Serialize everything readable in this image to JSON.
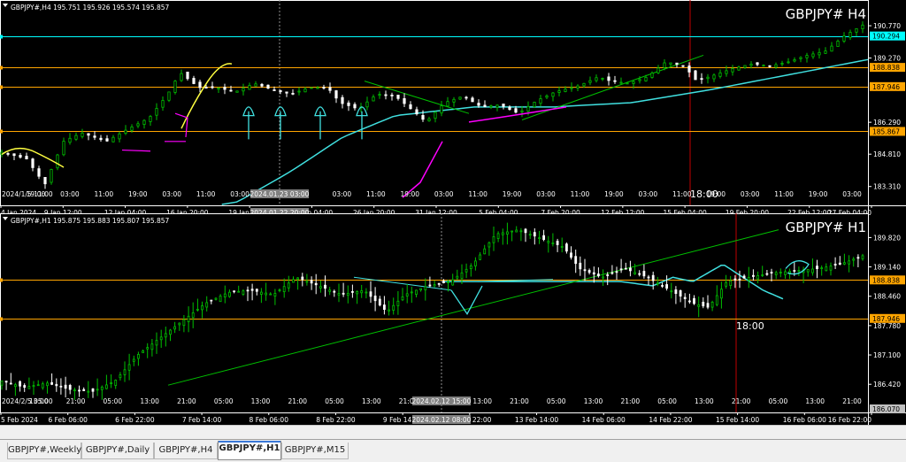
{
  "panes": [
    {
      "id": "h4",
      "info": "GBPJPY#,H4  195.751 195.926 195.574 195.857",
      "title": "GBPJPY# H4",
      "y_ticks": [
        "190.770",
        "189.270",
        "186.290",
        "184.810",
        "183.310"
      ],
      "y_range": [
        182.6,
        191.8
      ],
      "x_ticks": [
        "4 Jan 2024",
        "9 Jan 12:00",
        "12 Jan 04:00",
        "16 Jan 20:00",
        "19 Jan 12:00",
        "24 Jan 04:00",
        "26 Jan 20:00",
        "31 Jan 12:00",
        "5 Feb 04:00",
        "7 Feb 20:00",
        "12 Feb 12:00",
        "15 Feb 04:00",
        "19 Feb 20:00",
        "22 Feb 12:00",
        "27 Feb 04:00"
      ],
      "x_ticks_minor": [
        "2024/1/5 11:00",
        "19:00",
        "03:00",
        "11:00",
        "19:00",
        "03:00",
        "11:00",
        "03:00",
        "11:00",
        "19:00",
        "03:00",
        "11:00",
        "19:00",
        "03:00",
        "11:00",
        "19:00",
        "03:00",
        "11:00",
        "19:00",
        "03:00",
        "11:00",
        "19:00",
        "03:00",
        "11:00",
        "19:00",
        "03:00"
      ],
      "cursor_time_top": "2024.01.23 03:00",
      "cursor_time_bottom": "2024.01.22 20:00",
      "vline_label": "18:00",
      "price_labels": [
        {
          "text": "190.294",
          "value": 190.294,
          "bg": "#00ffff",
          "fg": "#000000"
        },
        {
          "text": "188.838",
          "value": 188.838,
          "bg": "#ffa500",
          "fg": "#000000"
        },
        {
          "text": "187.946",
          "value": 187.946,
          "bg": "#ffa500",
          "fg": "#000000"
        },
        {
          "text": "185.867",
          "value": 185.867,
          "bg": "#ffa500",
          "fg": "#000000"
        }
      ]
    },
    {
      "id": "h1",
      "info": "GBPJPY#,H1  195.875 195.883 195.807 195.857",
      "title": "GBPJPY# H1",
      "y_ticks": [
        "189.820",
        "189.140",
        "188.460",
        "187.780",
        "187.100",
        "186.420"
      ],
      "y_range": [
        185.85,
        190.3
      ],
      "x_ticks": [
        "5 Feb 2024",
        "6 Feb 06:00",
        "6 Feb 22:00",
        "7 Feb 14:00",
        "8 Feb 06:00",
        "8 Feb 22:00",
        "9 Feb 14:00",
        "12 Feb 22:00",
        "13 Feb 14:00",
        "14 Feb 06:00",
        "14 Feb 22:00",
        "15 Feb 14:00",
        "16 Feb 06:00",
        "16 Feb 22:00"
      ],
      "x_ticks_minor": [
        "2024/2/5 05:00",
        "13:00",
        "21:00",
        "05:00",
        "13:00",
        "21:00",
        "05:00",
        "13:00",
        "21:00",
        "05:00",
        "13:00",
        "21:00",
        "05:00",
        "13:00",
        "21:00",
        "05:00",
        "13:00",
        "21:00",
        "05:00",
        "13:00",
        "21:00",
        "05:00",
        "13:00",
        "21:00"
      ],
      "cursor_time_top": "2024.02.12 15:00",
      "cursor_time_bottom": "2024.02.12 08:00",
      "vline_label": "18:00",
      "price_labels": [
        {
          "text": "188.838",
          "value": 188.838,
          "bg": "#ffa500",
          "fg": "#000000"
        },
        {
          "text": "187.946",
          "value": 187.946,
          "bg": "#ffa500",
          "fg": "#000000"
        },
        {
          "text": "186.070",
          "value": 186.07,
          "bg": "#c0c0c0",
          "fg": "#000000"
        }
      ]
    }
  ],
  "tabs": [
    {
      "label": "GBPJPY#,Weekly",
      "active": false
    },
    {
      "label": "GBPJPY#,Daily",
      "active": false
    },
    {
      "label": "GBPJPY#,H4",
      "active": false
    },
    {
      "label": "GBPJPY#,H1",
      "active": true
    },
    {
      "label": "GBPJPY#,M15",
      "active": false
    }
  ],
  "colors": {
    "background": "#000000",
    "bull": "#00c000",
    "bear": "#ffffff",
    "ma": "#40e0e0",
    "orange_level": "#ffa500",
    "cyan_level": "#00ffff",
    "trendline": "#00c000",
    "annotation_magenta": "#ff00ff",
    "annotation_yellow": "#ffff40",
    "annotation_cyan": "#40e0e0",
    "vline_red": "#c00000",
    "axis_text": "#ffffff"
  },
  "chart_data": [
    {
      "type": "candlestick",
      "timeframe": "H4",
      "title": "GBPJPY# H4",
      "ylim": [
        182.6,
        191.8
      ],
      "series": [
        {
          "name": "Close",
          "x_range": [
            "2024-01-04",
            "2024-02-27 04:00"
          ],
          "anchors": [
            [
              0,
              184.9
            ],
            [
              8,
              184.6
            ],
            [
              14,
              183.4
            ],
            [
              20,
              185.4
            ],
            [
              26,
              185.8
            ],
            [
              34,
              185.4
            ],
            [
              40,
              185.9
            ],
            [
              48,
              186.5
            ],
            [
              54,
              187.6
            ],
            [
              58,
              188.6
            ],
            [
              64,
              187.9
            ],
            [
              70,
              187.9
            ],
            [
              76,
              187.7
            ],
            [
              82,
              188.1
            ],
            [
              88,
              187.8
            ],
            [
              94,
              187.6
            ],
            [
              100,
              187.9
            ],
            [
              106,
              187.9
            ],
            [
              110,
              187.2
            ],
            [
              116,
              186.9
            ],
            [
              122,
              187.6
            ],
            [
              128,
              187.5
            ],
            [
              134,
              186.8
            ],
            [
              138,
              186.3
            ],
            [
              144,
              187.2
            ],
            [
              150,
              187.5
            ],
            [
              156,
              187.0
            ],
            [
              162,
              187.1
            ],
            [
              168,
              186.7
            ],
            [
              174,
              187.3
            ],
            [
              180,
              187.7
            ],
            [
              188,
              188.0
            ],
            [
              194,
              188.4
            ],
            [
              198,
              188.2
            ],
            [
              204,
              188.1
            ],
            [
              210,
              188.4
            ],
            [
              216,
              189.1
            ],
            [
              222,
              188.9
            ],
            [
              226,
              188.2
            ],
            [
              232,
              188.5
            ],
            [
              238,
              188.8
            ],
            [
              244,
              189.0
            ],
            [
              250,
              188.9
            ],
            [
              256,
              189.1
            ],
            [
              262,
              189.4
            ],
            [
              268,
              189.6
            ],
            [
              274,
              190.3
            ],
            [
              280,
              190.8
            ]
          ]
        },
        {
          "name": "MA",
          "anchors": [
            [
              0,
              181.8
            ],
            [
              40,
              182.6
            ],
            [
              60,
              184.0
            ],
            [
              80,
              185.6
            ],
            [
              100,
              186.6
            ],
            [
              130,
              187.0
            ],
            [
              160,
              187.0
            ],
            [
              190,
              187.2
            ],
            [
              220,
              187.8
            ],
            [
              250,
              188.5
            ],
            [
              280,
              189.2
            ]
          ]
        }
      ],
      "levels": [
        190.294,
        188.838,
        187.946,
        185.867
      ]
    },
    {
      "type": "candlestick",
      "timeframe": "H1",
      "title": "GBPJPY# H1",
      "ylim": [
        185.85,
        190.3
      ],
      "series": [
        {
          "name": "Close",
          "x_range": [
            "2024-02-05 05:00",
            "2024-02-16 22:00"
          ],
          "anchors": [
            [
              0,
              186.5
            ],
            [
              10,
              186.35
            ],
            [
              20,
              186.45
            ],
            [
              30,
              186.3
            ],
            [
              40,
              186.25
            ],
            [
              50,
              186.5
            ],
            [
              60,
              187.1
            ],
            [
              70,
              187.5
            ],
            [
              80,
              187.9
            ],
            [
              90,
              188.3
            ],
            [
              100,
              188.55
            ],
            [
              110,
              188.6
            ],
            [
              120,
              188.5
            ],
            [
              130,
              188.9
            ],
            [
              140,
              188.7
            ],
            [
              150,
              188.5
            ],
            [
              160,
              188.6
            ],
            [
              170,
              188.1
            ],
            [
              178,
              188.5
            ],
            [
              188,
              188.7
            ],
            [
              198,
              188.8
            ],
            [
              208,
              189.2
            ],
            [
              218,
              189.9
            ],
            [
              228,
              190.0
            ],
            [
              238,
              189.8
            ],
            [
              248,
              189.6
            ],
            [
              255,
              189.1
            ],
            [
              265,
              188.9
            ],
            [
              275,
              189.1
            ],
            [
              285,
              188.9
            ],
            [
              295,
              188.6
            ],
            [
              305,
              188.3
            ],
            [
              312,
              188.2
            ],
            [
              320,
              188.8
            ],
            [
              330,
              188.9
            ],
            [
              340,
              189.0
            ],
            [
              350,
              189.05
            ],
            [
              360,
              189.1
            ],
            [
              370,
              189.2
            ],
            [
              380,
              189.4
            ]
          ]
        },
        {
          "name": "MA",
          "anchors": [
            [
              178,
              188.8
            ],
            [
              210,
              188.7
            ],
            [
              230,
              188.9
            ],
            [
              250,
              188.8
            ],
            [
              280,
              189.2
            ],
            [
              300,
              188.9
            ],
            [
              320,
              188.6
            ],
            [
              340,
              188.4
            ]
          ]
        }
      ],
      "levels": [
        188.838,
        187.946
      ]
    }
  ]
}
